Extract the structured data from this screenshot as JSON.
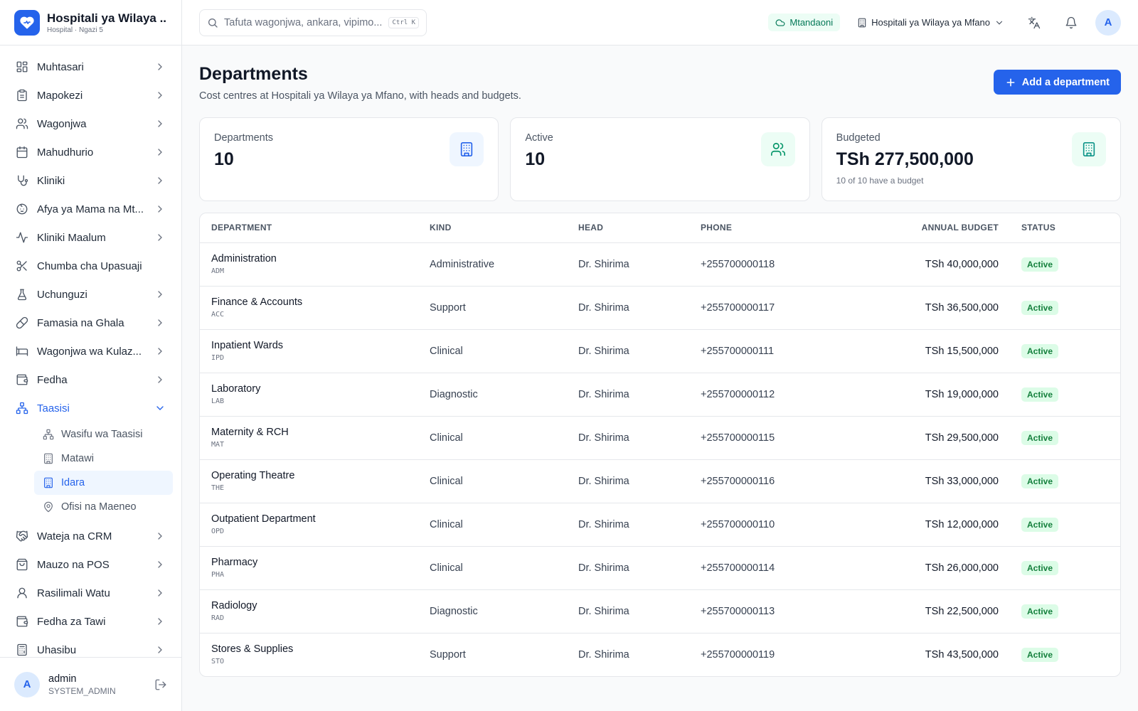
{
  "brand": {
    "title": "Hospitali ya Wilaya ...",
    "subtitle": "Hospital · Ngazi 5"
  },
  "nav": {
    "items": [
      {
        "label": "Muhtasari",
        "icon": "dashboard-icon"
      },
      {
        "label": "Mapokezi",
        "icon": "clipboard-icon"
      },
      {
        "label": "Wagonjwa",
        "icon": "users-icon"
      },
      {
        "label": "Mahudhurio",
        "icon": "calendar-icon"
      },
      {
        "label": "Kliniki",
        "icon": "stethoscope-icon"
      },
      {
        "label": "Afya ya Mama na Mt...",
        "icon": "baby-icon"
      },
      {
        "label": "Kliniki Maalum",
        "icon": "activity-icon"
      },
      {
        "label": "Chumba cha Upasuaji",
        "icon": "scissors-icon"
      },
      {
        "label": "Uchunguzi",
        "icon": "flask-icon"
      },
      {
        "label": "Famasia na Ghala",
        "icon": "pill-icon"
      },
      {
        "label": "Wagonjwa wa Kulaz...",
        "icon": "bed-icon"
      },
      {
        "label": "Fedha",
        "icon": "wallet-icon"
      }
    ],
    "active_group": {
      "label": "Taasisi",
      "icon": "network-icon"
    },
    "sub_items": [
      {
        "label": "Wasifu wa Taasisi",
        "icon": "network-icon"
      },
      {
        "label": "Matawi",
        "icon": "building-icon"
      },
      {
        "label": "Idara",
        "icon": "building-icon"
      },
      {
        "label": "Ofisi na Maeneo",
        "icon": "map-pin-icon"
      }
    ],
    "items_after": [
      {
        "label": "Wateja na CRM",
        "icon": "handshake-icon"
      },
      {
        "label": "Mauzo na POS",
        "icon": "shopping-bag-icon"
      },
      {
        "label": "Rasilimali Watu",
        "icon": "user-icon"
      },
      {
        "label": "Fedha za Tawi",
        "icon": "wallet-icon"
      },
      {
        "label": "Uhasibu",
        "icon": "calculator-icon"
      }
    ]
  },
  "user": {
    "initial": "A",
    "name": "admin",
    "role": "SYSTEM_ADMIN"
  },
  "topbar": {
    "search_placeholder": "Tafuta wagonjwa, ankara, vipimo...",
    "shortcut": "Ctrl K",
    "status": "Mtandaoni",
    "org": "Hospitali ya Wilaya ya Mfano",
    "avatar_initial": "A"
  },
  "page": {
    "title": "Departments",
    "subtitle": "Cost centres at Hospitali ya Wilaya ya Mfano, with heads and budgets.",
    "add_button": "Add a department"
  },
  "stats": [
    {
      "label": "Departments",
      "value": "10",
      "note": ""
    },
    {
      "label": "Active",
      "value": "10",
      "note": ""
    },
    {
      "label": "Budgeted",
      "value": "TSh 277,500,000",
      "note": "10 of 10 have a budget"
    }
  ],
  "table": {
    "headers": [
      "DEPARTMENT",
      "KIND",
      "HEAD",
      "PHONE",
      "ANNUAL BUDGET",
      "STATUS"
    ],
    "rows": [
      {
        "name": "Administration",
        "code": "ADM",
        "kind": "Administrative",
        "head": "Dr. Shirima",
        "phone": "+255700000118",
        "budget": "TSh 40,000,000",
        "status": "Active"
      },
      {
        "name": "Finance & Accounts",
        "code": "ACC",
        "kind": "Support",
        "head": "Dr. Shirima",
        "phone": "+255700000117",
        "budget": "TSh 36,500,000",
        "status": "Active"
      },
      {
        "name": "Inpatient Wards",
        "code": "IPD",
        "kind": "Clinical",
        "head": "Dr. Shirima",
        "phone": "+255700000111",
        "budget": "TSh 15,500,000",
        "status": "Active"
      },
      {
        "name": "Laboratory",
        "code": "LAB",
        "kind": "Diagnostic",
        "head": "Dr. Shirima",
        "phone": "+255700000112",
        "budget": "TSh 19,000,000",
        "status": "Active"
      },
      {
        "name": "Maternity & RCH",
        "code": "MAT",
        "kind": "Clinical",
        "head": "Dr. Shirima",
        "phone": "+255700000115",
        "budget": "TSh 29,500,000",
        "status": "Active"
      },
      {
        "name": "Operating Theatre",
        "code": "THE",
        "kind": "Clinical",
        "head": "Dr. Shirima",
        "phone": "+255700000116",
        "budget": "TSh 33,000,000",
        "status": "Active"
      },
      {
        "name": "Outpatient Department",
        "code": "OPD",
        "kind": "Clinical",
        "head": "Dr. Shirima",
        "phone": "+255700000110",
        "budget": "TSh 12,000,000",
        "status": "Active"
      },
      {
        "name": "Pharmacy",
        "code": "PHA",
        "kind": "Clinical",
        "head": "Dr. Shirima",
        "phone": "+255700000114",
        "budget": "TSh 26,000,000",
        "status": "Active"
      },
      {
        "name": "Radiology",
        "code": "RAD",
        "kind": "Diagnostic",
        "head": "Dr. Shirima",
        "phone": "+255700000113",
        "budget": "TSh 22,500,000",
        "status": "Active"
      },
      {
        "name": "Stores & Supplies",
        "code": "STO",
        "kind": "Support",
        "head": "Dr. Shirima",
        "phone": "+255700000119",
        "budget": "TSh 43,500,000",
        "status": "Active"
      }
    ]
  },
  "colors": {
    "accent": "#2563eb",
    "success": "#15803d",
    "success_bg": "#dcfce7"
  }
}
